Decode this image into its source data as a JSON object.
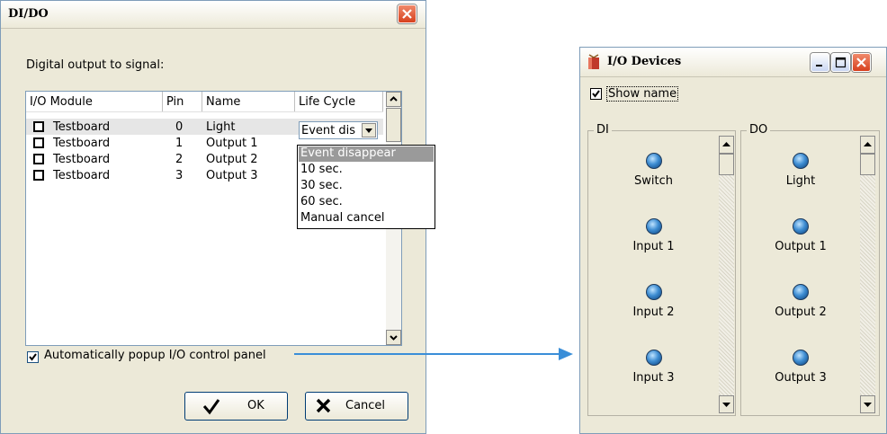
{
  "didoDialog": {
    "title": "DI/DO",
    "caption": "Digital output to signal:",
    "columns": [
      "I/O Module",
      "Pin",
      "Name",
      "Life Cycle"
    ],
    "rows": [
      {
        "module": "Testboard",
        "pin": "0",
        "name": "Light",
        "lifecycle": "Event dis",
        "checked": false,
        "selected": true
      },
      {
        "module": "Testboard",
        "pin": "1",
        "name": "Output 1",
        "lifecycle": "",
        "checked": false,
        "selected": false
      },
      {
        "module": "Testboard",
        "pin": "2",
        "name": "Output 2",
        "lifecycle": "",
        "checked": false,
        "selected": false
      },
      {
        "module": "Testboard",
        "pin": "3",
        "name": "Output 3",
        "lifecycle": "",
        "checked": false,
        "selected": false
      }
    ],
    "lifecycleOptions": [
      "Event disappear",
      "10 sec.",
      "30 sec.",
      "60 sec.",
      "Manual cancel"
    ],
    "autoPopupLabel": "Automatically popup I/O control panel",
    "autoPopupChecked": true,
    "okLabel": "OK",
    "cancelLabel": "Cancel"
  },
  "ioDevices": {
    "title": "I/O Devices",
    "showNameLabel": "Show name",
    "showNameChecked": true,
    "diGroupLabel": "DI",
    "doGroupLabel": "DO",
    "diItems": [
      "Switch",
      "Input 1",
      "Input 2",
      "Input 3"
    ],
    "doItems": [
      "Light",
      "Output 1",
      "Output 2",
      "Output 3"
    ]
  },
  "colors": {
    "connector": "#3a8ed8",
    "dialogBg": "#ECE9D8"
  }
}
